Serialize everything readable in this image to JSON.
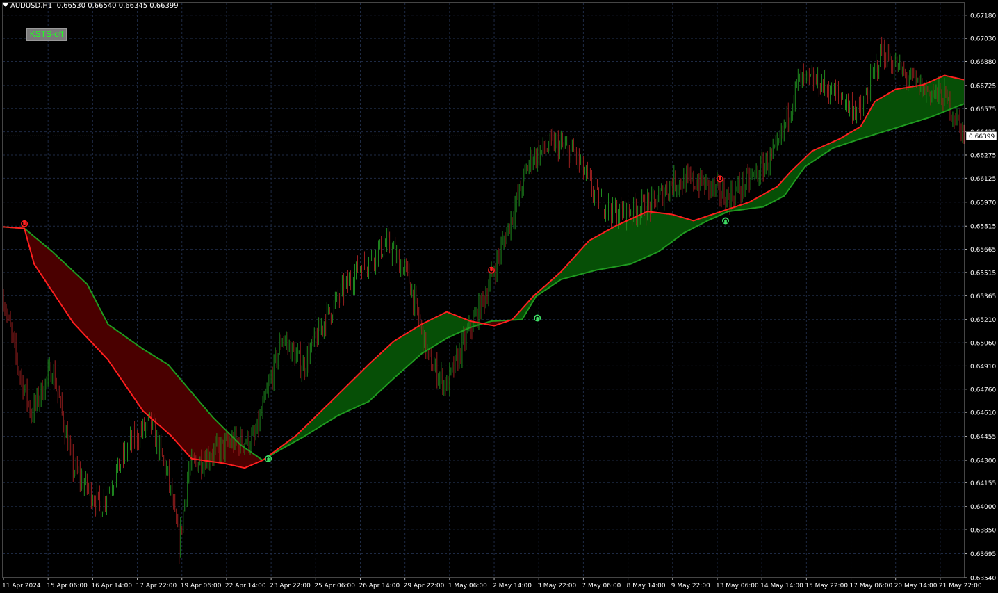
{
  "header": {
    "symbol": "AUDUSD,H1",
    "ohlc": "0.66530 0.66540 0.66345 0.66399"
  },
  "toggle_button": {
    "label": "KSTS-off",
    "text_color": "#22ff22"
  },
  "price_tag": "0.66399",
  "colors": {
    "background": "#000000",
    "grid": "#1e2a44",
    "bull_candle": "#1f8a1f",
    "bear_candle": "#9a1f1f",
    "up_band_fill": "#064f06",
    "down_band_fill": "#4a0000",
    "fast_line": "#ff1f1f",
    "slow_line": "#1f9a1f",
    "signal_up": "#3ddc64",
    "signal_down": "#ff2020"
  },
  "chart_data": {
    "type": "candlestick",
    "symbol": "AUDUSD",
    "timeframe": "H1",
    "ylim": [
      0.6354,
      0.6726
    ],
    "y_ticks": [
      "0.67180",
      "0.67030",
      "0.66880",
      "0.66725",
      "0.66575",
      "0.66425",
      "0.66275",
      "0.66125",
      "0.65970",
      "0.65815",
      "0.65665",
      "0.65515",
      "0.65365",
      "0.65210",
      "0.65060",
      "0.64910",
      "0.64760",
      "0.64610",
      "0.64455",
      "0.64300",
      "0.64155",
      "0.64000",
      "0.63850",
      "0.63695",
      "0.63540"
    ],
    "x_ticks": [
      "11 Apr 2024",
      "15 Apr 06:00",
      "16 Apr 14:00",
      "17 Apr 22:00",
      "19 Apr 06:00",
      "22 Apr 14:00",
      "23 Apr 22:00",
      "25 Apr 06:00",
      "26 Apr 14:00",
      "29 Apr 22:00",
      "1 May 06:00",
      "2 May 14:00",
      "3 May 22:00",
      "7 May 06:00",
      "8 May 14:00",
      "9 May 22:00",
      "13 May 06:00",
      "14 May 14:00",
      "15 May 22:00",
      "17 May 06:00",
      "20 May 14:00",
      "21 May 22:00"
    ],
    "x_tick_index": [
      0,
      32,
      64,
      96,
      128,
      160,
      192,
      224,
      256,
      288,
      320,
      352,
      384,
      416,
      448,
      480,
      512,
      544,
      576,
      608,
      640,
      672
    ],
    "bars_total": 690,
    "last_price": 0.66399,
    "price_anchors": [
      [
        0,
        0.6535
      ],
      [
        10,
        0.6492
      ],
      [
        20,
        0.646
      ],
      [
        35,
        0.649
      ],
      [
        50,
        0.6425
      ],
      [
        70,
        0.64
      ],
      [
        90,
        0.644
      ],
      [
        105,
        0.6455
      ],
      [
        118,
        0.642
      ],
      [
        126,
        0.6375
      ],
      [
        133,
        0.6425
      ],
      [
        150,
        0.6435
      ],
      [
        165,
        0.6442
      ],
      [
        180,
        0.6443
      ],
      [
        200,
        0.651
      ],
      [
        215,
        0.649
      ],
      [
        230,
        0.652
      ],
      [
        255,
        0.6555
      ],
      [
        275,
        0.657
      ],
      [
        290,
        0.655
      ],
      [
        305,
        0.6495
      ],
      [
        318,
        0.6478
      ],
      [
        332,
        0.651
      ],
      [
        345,
        0.6535
      ],
      [
        360,
        0.6575
      ],
      [
        378,
        0.6625
      ],
      [
        395,
        0.6635
      ],
      [
        410,
        0.6628
      ],
      [
        425,
        0.66
      ],
      [
        440,
        0.659
      ],
      [
        465,
        0.6595
      ],
      [
        480,
        0.661
      ],
      [
        500,
        0.661
      ],
      [
        520,
        0.66
      ],
      [
        540,
        0.6615
      ],
      [
        555,
        0.663
      ],
      [
        570,
        0.6675
      ],
      [
        585,
        0.6675
      ],
      [
        600,
        0.6665
      ],
      [
        615,
        0.6655
      ],
      [
        630,
        0.6695
      ],
      [
        645,
        0.668
      ],
      [
        660,
        0.667
      ],
      [
        675,
        0.6665
      ],
      [
        690,
        0.66399
      ]
    ],
    "fast_line": [
      [
        0,
        0.6581
      ],
      [
        15,
        0.658
      ],
      [
        22,
        0.6557
      ],
      [
        50,
        0.6519
      ],
      [
        75,
        0.6495
      ],
      [
        100,
        0.6462
      ],
      [
        120,
        0.6446
      ],
      [
        135,
        0.6431
      ],
      [
        158,
        0.6428
      ],
      [
        173,
        0.6425
      ],
      [
        186,
        0.643
      ],
      [
        195,
        0.6436
      ],
      [
        210,
        0.6446
      ],
      [
        235,
        0.6468
      ],
      [
        262,
        0.6492
      ],
      [
        280,
        0.6507
      ],
      [
        300,
        0.6518
      ],
      [
        318,
        0.6526
      ],
      [
        335,
        0.652
      ],
      [
        352,
        0.6517
      ],
      [
        365,
        0.6521
      ],
      [
        380,
        0.6536
      ],
      [
        400,
        0.6552
      ],
      [
        420,
        0.6572
      ],
      [
        440,
        0.6582
      ],
      [
        462,
        0.6591
      ],
      [
        480,
        0.6589
      ],
      [
        495,
        0.6585
      ],
      [
        515,
        0.6591
      ],
      [
        535,
        0.6597
      ],
      [
        555,
        0.6607
      ],
      [
        565,
        0.6617
      ],
      [
        580,
        0.663
      ],
      [
        600,
        0.6638
      ],
      [
        615,
        0.6646
      ],
      [
        625,
        0.6662
      ],
      [
        640,
        0.667
      ],
      [
        660,
        0.6673
      ],
      [
        675,
        0.6679
      ],
      [
        690,
        0.6676
      ]
    ],
    "slow_line": [
      [
        0,
        0.6581
      ],
      [
        15,
        0.658
      ],
      [
        35,
        0.6565
      ],
      [
        60,
        0.6544
      ],
      [
        75,
        0.6518
      ],
      [
        100,
        0.6502
      ],
      [
        118,
        0.6492
      ],
      [
        133,
        0.6476
      ],
      [
        150,
        0.6458
      ],
      [
        170,
        0.644
      ],
      [
        186,
        0.643
      ],
      [
        195,
        0.6435
      ],
      [
        215,
        0.6445
      ],
      [
        240,
        0.6459
      ],
      [
        262,
        0.6468
      ],
      [
        280,
        0.6483
      ],
      [
        300,
        0.6499
      ],
      [
        318,
        0.6509
      ],
      [
        335,
        0.6516
      ],
      [
        350,
        0.652
      ],
      [
        372,
        0.6521
      ],
      [
        382,
        0.6536
      ],
      [
        400,
        0.6547
      ],
      [
        425,
        0.6553
      ],
      [
        450,
        0.6557
      ],
      [
        470,
        0.6565
      ],
      [
        488,
        0.6577
      ],
      [
        505,
        0.6585
      ],
      [
        520,
        0.6591
      ],
      [
        545,
        0.6594
      ],
      [
        560,
        0.6601
      ],
      [
        575,
        0.662
      ],
      [
        595,
        0.6632
      ],
      [
        615,
        0.6638
      ],
      [
        640,
        0.6645
      ],
      [
        665,
        0.6652
      ],
      [
        690,
        0.6661
      ]
    ],
    "signals": [
      {
        "type": "sell",
        "bar": 15,
        "price": 0.6583
      },
      {
        "type": "buy",
        "bar": 190,
        "price": 0.6431
      },
      {
        "type": "sell",
        "bar": 350,
        "price": 0.6553
      },
      {
        "type": "buy",
        "bar": 383,
        "price": 0.6522
      },
      {
        "type": "sell",
        "bar": 514,
        "price": 0.6612
      },
      {
        "type": "buy",
        "bar": 518,
        "price": 0.6585
      }
    ]
  }
}
